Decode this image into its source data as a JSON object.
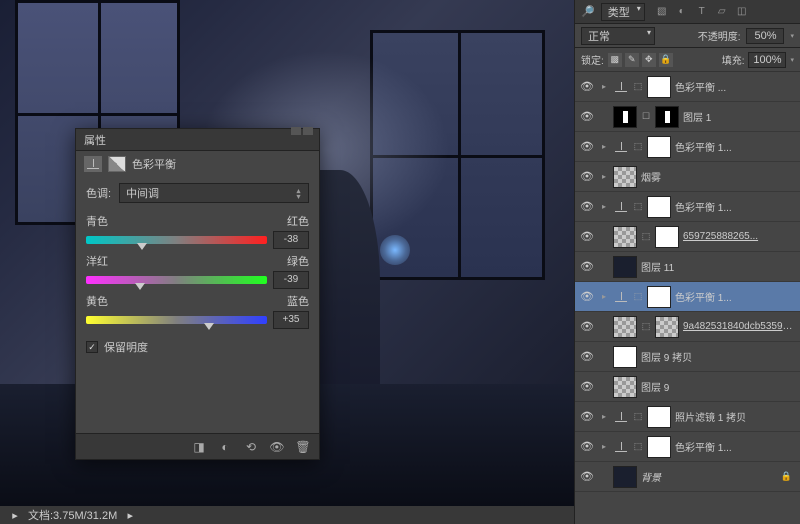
{
  "status": {
    "doc_info": "文档:3.75M/31.2M"
  },
  "properties": {
    "header": "属性",
    "title": "色彩平衡",
    "tone_label": "色调:",
    "tone_value": "中间调",
    "sliders": [
      {
        "left": "青色",
        "right": "红色",
        "value": "-38",
        "pos": 31
      },
      {
        "left": "洋红",
        "right": "绿色",
        "value": "-39",
        "pos": 30
      },
      {
        "left": "黄色",
        "right": "蓝色",
        "value": "+35",
        "pos": 68
      }
    ],
    "preserve_lum": "保留明度"
  },
  "layers_panel": {
    "kind_label": "类型",
    "blend_mode": "正常",
    "opacity_label": "不透明度:",
    "opacity_value": "50%",
    "lock_label": "锁定:",
    "fill_label": "填充:",
    "fill_value": "100%"
  },
  "layers": [
    {
      "type": "adj",
      "name": "色彩平衡 ...",
      "expand": true
    },
    {
      "type": "mask",
      "name": "图层 1"
    },
    {
      "type": "adj",
      "name": "色彩平衡 1...",
      "expand": true
    },
    {
      "type": "normal",
      "name": "烟雾",
      "thumb": "trans",
      "expand": true
    },
    {
      "type": "adj",
      "name": "色彩平衡 1...",
      "expand": true
    },
    {
      "type": "link",
      "name": "659725888265...",
      "thumb": "trans",
      "mask": "white"
    },
    {
      "type": "normal",
      "name": "图层 11",
      "thumb": "dark"
    },
    {
      "type": "adj",
      "name": "色彩平衡 1...",
      "expand": true,
      "selected": true
    },
    {
      "type": "link",
      "name": "9a482531840dcb535990...",
      "thumb": "trans"
    },
    {
      "type": "normal",
      "name": "图层 9 拷贝",
      "thumb": "white"
    },
    {
      "type": "normal",
      "name": "图层 9",
      "thumb": "trans-fig"
    },
    {
      "type": "adj",
      "name": "照片滤镜 1 拷贝",
      "expand": true,
      "icon": "filter"
    },
    {
      "type": "adj",
      "name": "色彩平衡 1...",
      "expand": true
    },
    {
      "type": "bg",
      "name": "背景",
      "thumb": "dark"
    }
  ]
}
